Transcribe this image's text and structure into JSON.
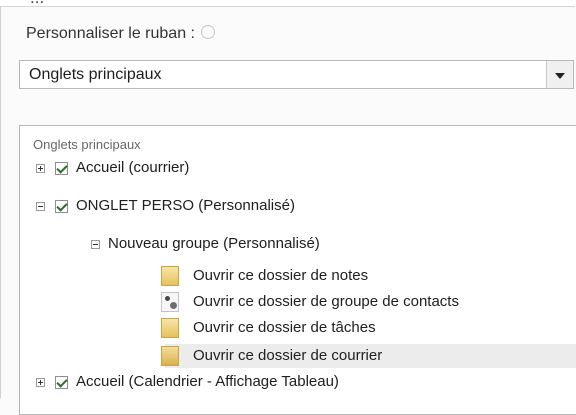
{
  "cut_off_text": "...",
  "ribbon": {
    "heading": "Personnaliser le ruban :",
    "dropdown_value": "Onglets principaux"
  },
  "tree": {
    "caption": "Onglets principaux",
    "items": [
      {
        "label": "Accueil (courrier)",
        "checked": true,
        "expanded": false
      },
      {
        "label": "ONGLET PERSO (Personnalisé)",
        "checked": true,
        "expanded": true
      },
      {
        "label": "Nouveau groupe (Personnalisé)",
        "expanded": true
      },
      {
        "label": "Ouvrir ce dossier de notes",
        "icon": "notes-folder-icon"
      },
      {
        "label": "Ouvrir ce dossier de groupe de contacts",
        "icon": "contact-group-folder-icon"
      },
      {
        "label": "Ouvrir ce dossier de tâches",
        "icon": "tasks-folder-icon"
      },
      {
        "label": "Ouvrir ce dossier de courrier",
        "icon": "mail-folder-icon",
        "selected": true
      },
      {
        "label": "Accueil (Calendrier - Affichage Tableau)",
        "checked": true,
        "expanded": false
      }
    ]
  }
}
